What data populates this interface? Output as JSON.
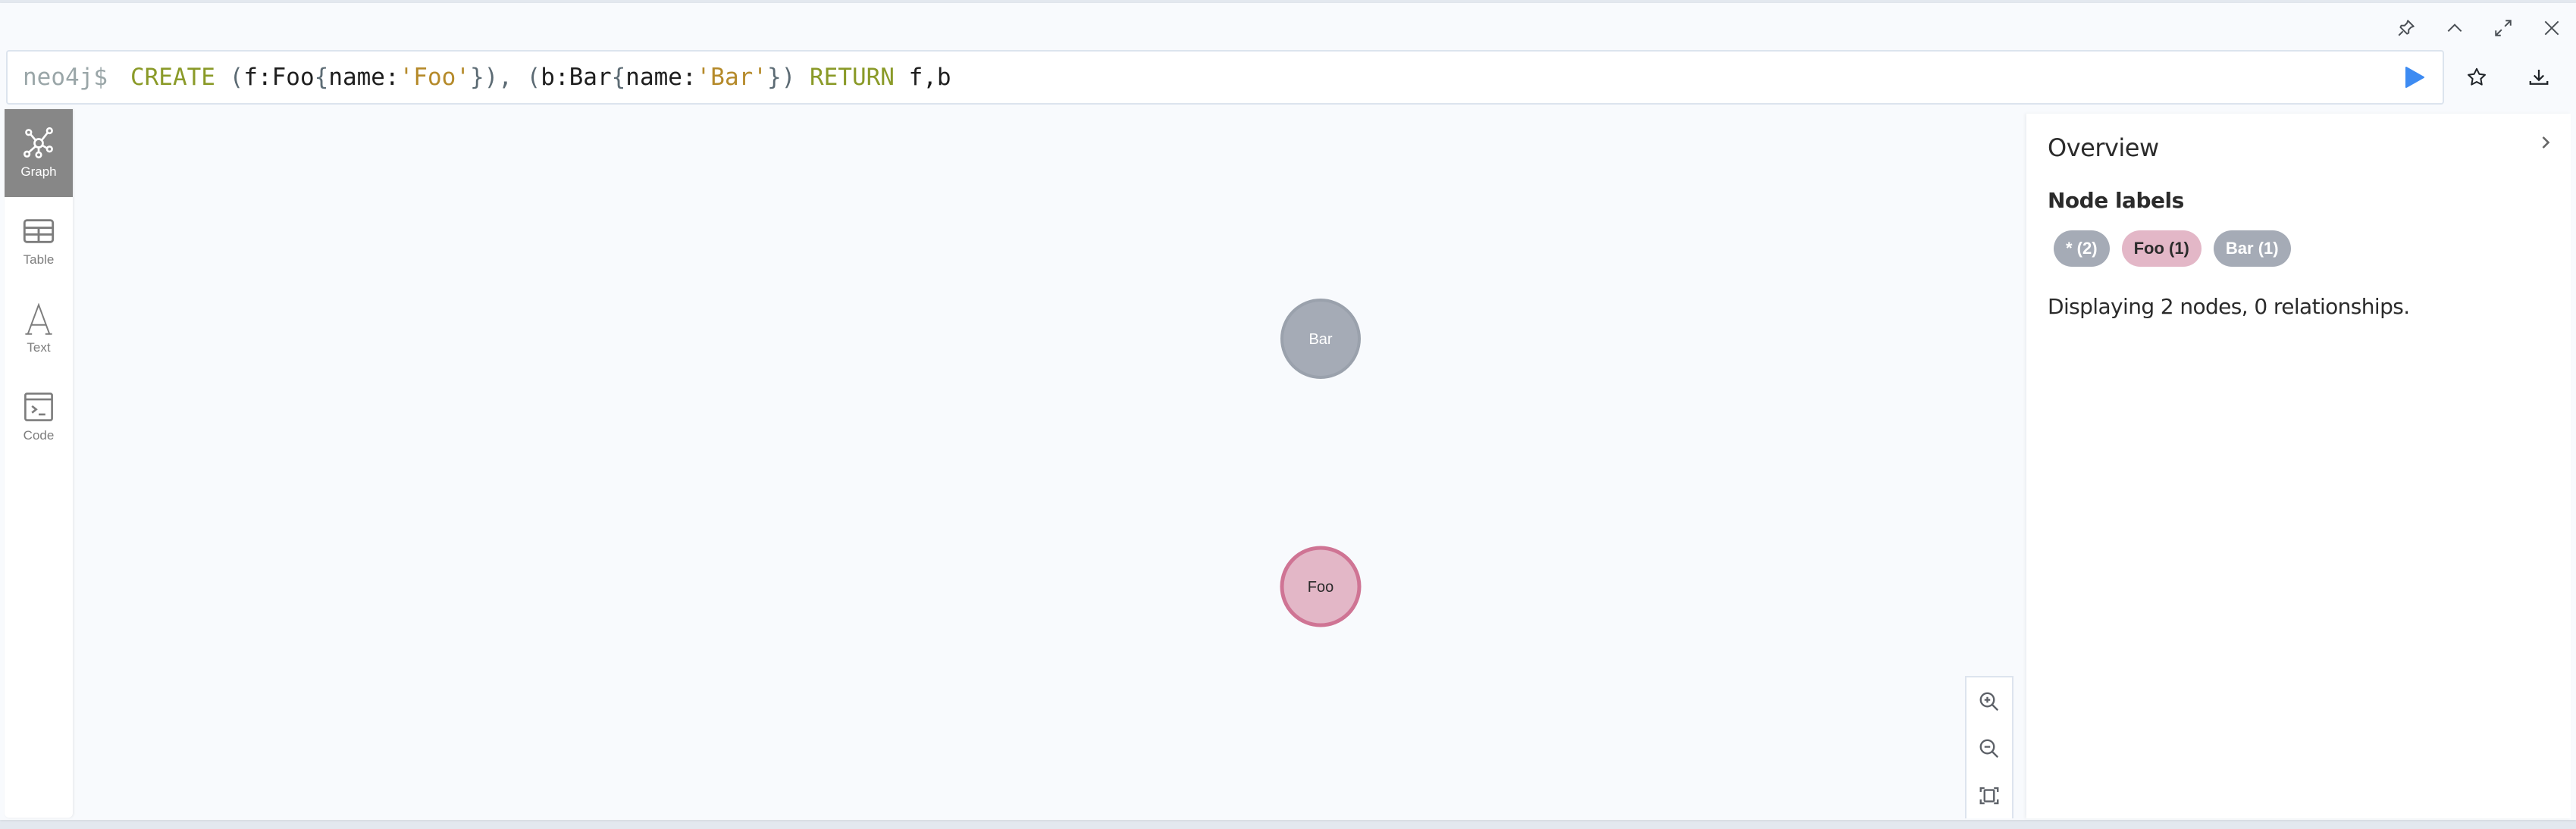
{
  "frame_controls": [
    {
      "name": "pin-icon",
      "label": "Pin"
    },
    {
      "name": "chevron-up-icon",
      "label": "Collapse"
    },
    {
      "name": "expand-icon",
      "label": "Fullscreen"
    },
    {
      "name": "close-icon",
      "label": "Close"
    }
  ],
  "editor": {
    "prompt": "neo4j$",
    "query_tokens": [
      {
        "t": "CREATE",
        "c": "kw"
      },
      {
        "t": " ",
        "c": "ident"
      },
      {
        "t": "(",
        "c": "punc"
      },
      {
        "t": "f:Foo",
        "c": "ident"
      },
      {
        "t": "{",
        "c": "punc"
      },
      {
        "t": "name:",
        "c": "ident"
      },
      {
        "t": "'Foo'",
        "c": "str"
      },
      {
        "t": "})",
        "c": "punc"
      },
      {
        "t": ", ",
        "c": "punc"
      },
      {
        "t": "(",
        "c": "punc"
      },
      {
        "t": "b:Bar",
        "c": "ident"
      },
      {
        "t": "{",
        "c": "punc"
      },
      {
        "t": "name:",
        "c": "ident"
      },
      {
        "t": "'Bar'",
        "c": "str"
      },
      {
        "t": "})",
        "c": "punc"
      },
      {
        "t": " ",
        "c": "ident"
      },
      {
        "t": "RETURN",
        "c": "kw"
      },
      {
        "t": " f,b",
        "c": "ident"
      }
    ],
    "query": "CREATE (f:Foo{name:'Foo'}), (b:Bar{name:'Bar'}) RETURN f,b",
    "run_color": "#3d8bf2"
  },
  "sidebar": {
    "tabs": [
      {
        "label": "Graph",
        "icon": "graph-icon",
        "active": true
      },
      {
        "label": "Table",
        "icon": "table-icon",
        "active": false
      },
      {
        "label": "Text",
        "icon": "text-icon",
        "active": false
      },
      {
        "label": "Code",
        "icon": "code-icon",
        "active": false
      }
    ]
  },
  "graph": {
    "nodes": [
      {
        "label": "Bar",
        "type": "Bar",
        "fill": "#a5abb6",
        "stroke": "#9aa1ac",
        "text_color": "#ffffff"
      },
      {
        "label": "Foo",
        "type": "Foo",
        "fill": "#e3b7c7",
        "stroke": "#cf7494",
        "text_color": "#2b2b2b"
      }
    ],
    "relationships": []
  },
  "overview": {
    "title": "Overview",
    "node_labels_title": "Node labels",
    "pills": [
      {
        "label": "* (2)",
        "bg": "#a5abb6",
        "color": "#ffffff"
      },
      {
        "label": "Foo (1)",
        "bg": "#e3b7c7",
        "color": "#2b2b2b"
      },
      {
        "label": "Bar (1)",
        "bg": "#a5abb6",
        "color": "#ffffff"
      }
    ],
    "summary": "Displaying 2 nodes, 0 relationships."
  }
}
